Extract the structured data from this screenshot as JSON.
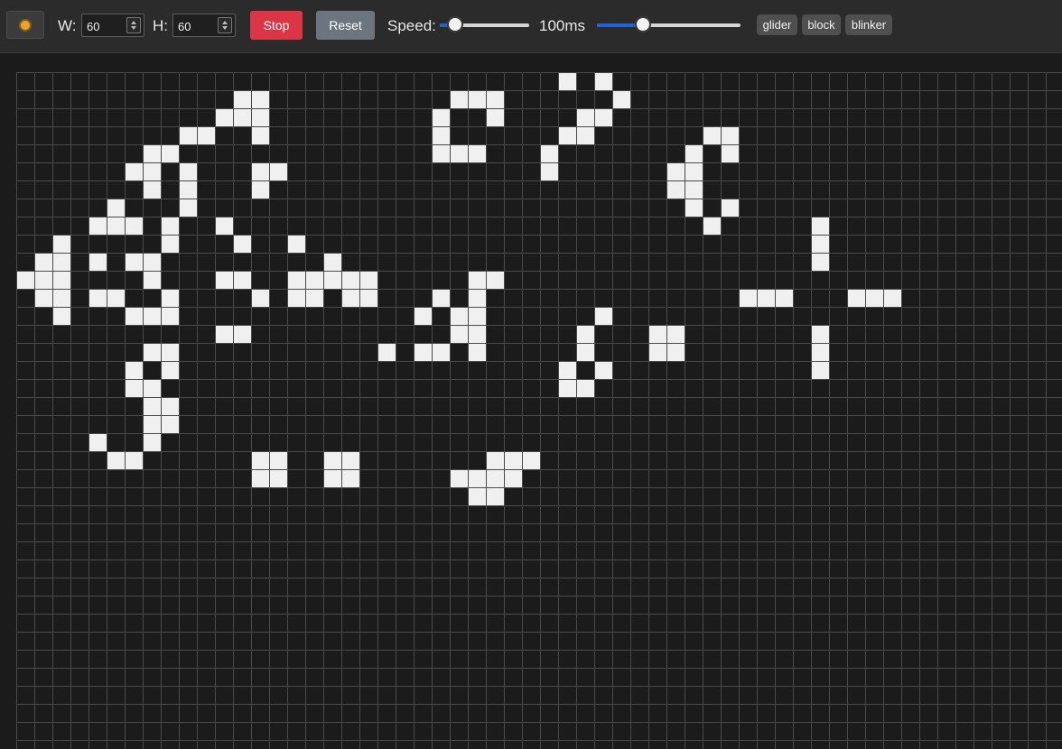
{
  "toolbar": {
    "theme_icon": "sun-icon",
    "width_label": "W:",
    "width_value": "60",
    "height_label": "H:",
    "height_value": "60",
    "stop_label": "Stop",
    "reset_label": "Reset",
    "speed_label": "Speed:",
    "speed_value": "100ms",
    "speed_slider_level": 0.1,
    "second_slider_level": 0.3,
    "presets": [
      "glider",
      "block",
      "blinker"
    ],
    "colors": {
      "stop": "#dc3545",
      "reset": "#6c757d",
      "accent": "#1e63d6"
    }
  },
  "board": {
    "live_color": "#f0f0f0",
    "dead_color": "#1b1b1b",
    "grid_line_color": "#4a4a4a",
    "visible_cols": 58,
    "visible_rows": 38,
    "live_cells": [
      [
        30,
        0
      ],
      [
        32,
        0
      ],
      [
        12,
        1
      ],
      [
        13,
        1
      ],
      [
        24,
        1
      ],
      [
        25,
        1
      ],
      [
        26,
        1
      ],
      [
        33,
        1
      ],
      [
        11,
        2
      ],
      [
        12,
        2
      ],
      [
        13,
        2
      ],
      [
        23,
        2
      ],
      [
        26,
        2
      ],
      [
        31,
        2
      ],
      [
        32,
        2
      ],
      [
        9,
        3
      ],
      [
        10,
        3
      ],
      [
        13,
        3
      ],
      [
        23,
        3
      ],
      [
        30,
        3
      ],
      [
        31,
        3
      ],
      [
        38,
        3
      ],
      [
        39,
        3
      ],
      [
        7,
        4
      ],
      [
        8,
        4
      ],
      [
        23,
        4
      ],
      [
        24,
        4
      ],
      [
        25,
        4
      ],
      [
        29,
        4
      ],
      [
        37,
        4
      ],
      [
        39,
        4
      ],
      [
        6,
        5
      ],
      [
        7,
        5
      ],
      [
        9,
        5
      ],
      [
        13,
        5
      ],
      [
        14,
        5
      ],
      [
        29,
        5
      ],
      [
        36,
        5
      ],
      [
        37,
        5
      ],
      [
        7,
        6
      ],
      [
        9,
        6
      ],
      [
        13,
        6
      ],
      [
        36,
        6
      ],
      [
        37,
        6
      ],
      [
        5,
        7
      ],
      [
        9,
        7
      ],
      [
        37,
        7
      ],
      [
        39,
        7
      ],
      [
        4,
        8
      ],
      [
        5,
        8
      ],
      [
        6,
        8
      ],
      [
        8,
        8
      ],
      [
        11,
        8
      ],
      [
        38,
        8
      ],
      [
        44,
        8
      ],
      [
        2,
        9
      ],
      [
        8,
        9
      ],
      [
        12,
        9
      ],
      [
        15,
        9
      ],
      [
        44,
        9
      ],
      [
        1,
        10
      ],
      [
        2,
        10
      ],
      [
        4,
        10
      ],
      [
        6,
        10
      ],
      [
        7,
        10
      ],
      [
        17,
        10
      ],
      [
        44,
        10
      ],
      [
        0,
        11
      ],
      [
        1,
        11
      ],
      [
        2,
        11
      ],
      [
        7,
        11
      ],
      [
        11,
        11
      ],
      [
        12,
        11
      ],
      [
        15,
        11
      ],
      [
        16,
        11
      ],
      [
        17,
        11
      ],
      [
        18,
        11
      ],
      [
        19,
        11
      ],
      [
        25,
        11
      ],
      [
        26,
        11
      ],
      [
        1,
        12
      ],
      [
        2,
        12
      ],
      [
        4,
        12
      ],
      [
        5,
        12
      ],
      [
        8,
        12
      ],
      [
        13,
        12
      ],
      [
        15,
        12
      ],
      [
        16,
        12
      ],
      [
        18,
        12
      ],
      [
        19,
        12
      ],
      [
        23,
        12
      ],
      [
        25,
        12
      ],
      [
        40,
        12
      ],
      [
        41,
        12
      ],
      [
        42,
        12
      ],
      [
        46,
        12
      ],
      [
        47,
        12
      ],
      [
        48,
        12
      ],
      [
        2,
        13
      ],
      [
        6,
        13
      ],
      [
        7,
        13
      ],
      [
        8,
        13
      ],
      [
        22,
        13
      ],
      [
        24,
        13
      ],
      [
        25,
        13
      ],
      [
        32,
        13
      ],
      [
        11,
        14
      ],
      [
        12,
        14
      ],
      [
        24,
        14
      ],
      [
        25,
        14
      ],
      [
        31,
        14
      ],
      [
        35,
        14
      ],
      [
        36,
        14
      ],
      [
        44,
        14
      ],
      [
        7,
        15
      ],
      [
        8,
        15
      ],
      [
        20,
        15
      ],
      [
        22,
        15
      ],
      [
        23,
        15
      ],
      [
        25,
        15
      ],
      [
        31,
        15
      ],
      [
        35,
        15
      ],
      [
        36,
        15
      ],
      [
        44,
        15
      ],
      [
        6,
        16
      ],
      [
        8,
        16
      ],
      [
        30,
        16
      ],
      [
        32,
        16
      ],
      [
        44,
        16
      ],
      [
        6,
        17
      ],
      [
        7,
        17
      ],
      [
        30,
        17
      ],
      [
        31,
        17
      ],
      [
        7,
        18
      ],
      [
        8,
        18
      ],
      [
        7,
        19
      ],
      [
        8,
        19
      ],
      [
        4,
        20
      ],
      [
        7,
        20
      ],
      [
        5,
        21
      ],
      [
        6,
        21
      ],
      [
        13,
        21
      ],
      [
        14,
        21
      ],
      [
        17,
        21
      ],
      [
        18,
        21
      ],
      [
        26,
        21
      ],
      [
        27,
        21
      ],
      [
        28,
        21
      ],
      [
        13,
        22
      ],
      [
        14,
        22
      ],
      [
        17,
        22
      ],
      [
        18,
        22
      ],
      [
        24,
        22
      ],
      [
        25,
        22
      ],
      [
        26,
        22
      ],
      [
        27,
        22
      ],
      [
        25,
        23
      ],
      [
        26,
        23
      ]
    ]
  }
}
